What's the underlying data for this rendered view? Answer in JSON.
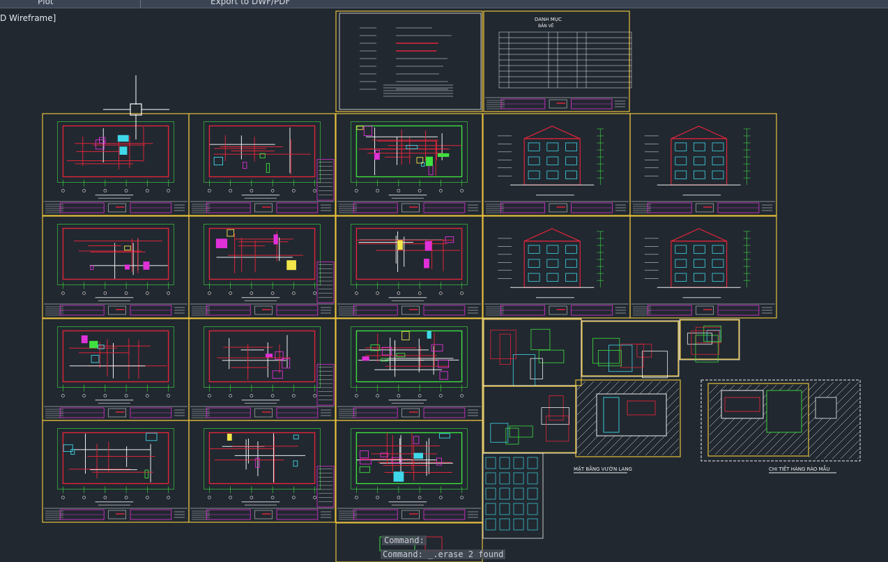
{
  "ribbon": {
    "plot_label": "Plot",
    "export_label": "Export to DWF/PDF"
  },
  "viewport": {
    "visual_style_label": "D Wireframe]"
  },
  "command": {
    "history_line": "Command:",
    "current_line": "Command: _.erase 2 found"
  },
  "drawing_titles": {
    "cover_title": "BẢN VẼ",
    "index_title": "DANH MỤC",
    "index_subtitle": "BẢN VẼ",
    "garden_plan": "MẶT BẰNG VƯỜN LANG",
    "detail_label": "CHI TIẾT HÀNG RÀO MẪU"
  },
  "colors": {
    "background": "#212830",
    "sheet_border": "#e8c13c",
    "wall_red": "#e0253a",
    "dim_green": "#3fe03f",
    "accent_magenta": "#e030d8",
    "white": "#f0f0f0",
    "cyan": "#3fd8e8",
    "yellow": "#f2e64a"
  }
}
